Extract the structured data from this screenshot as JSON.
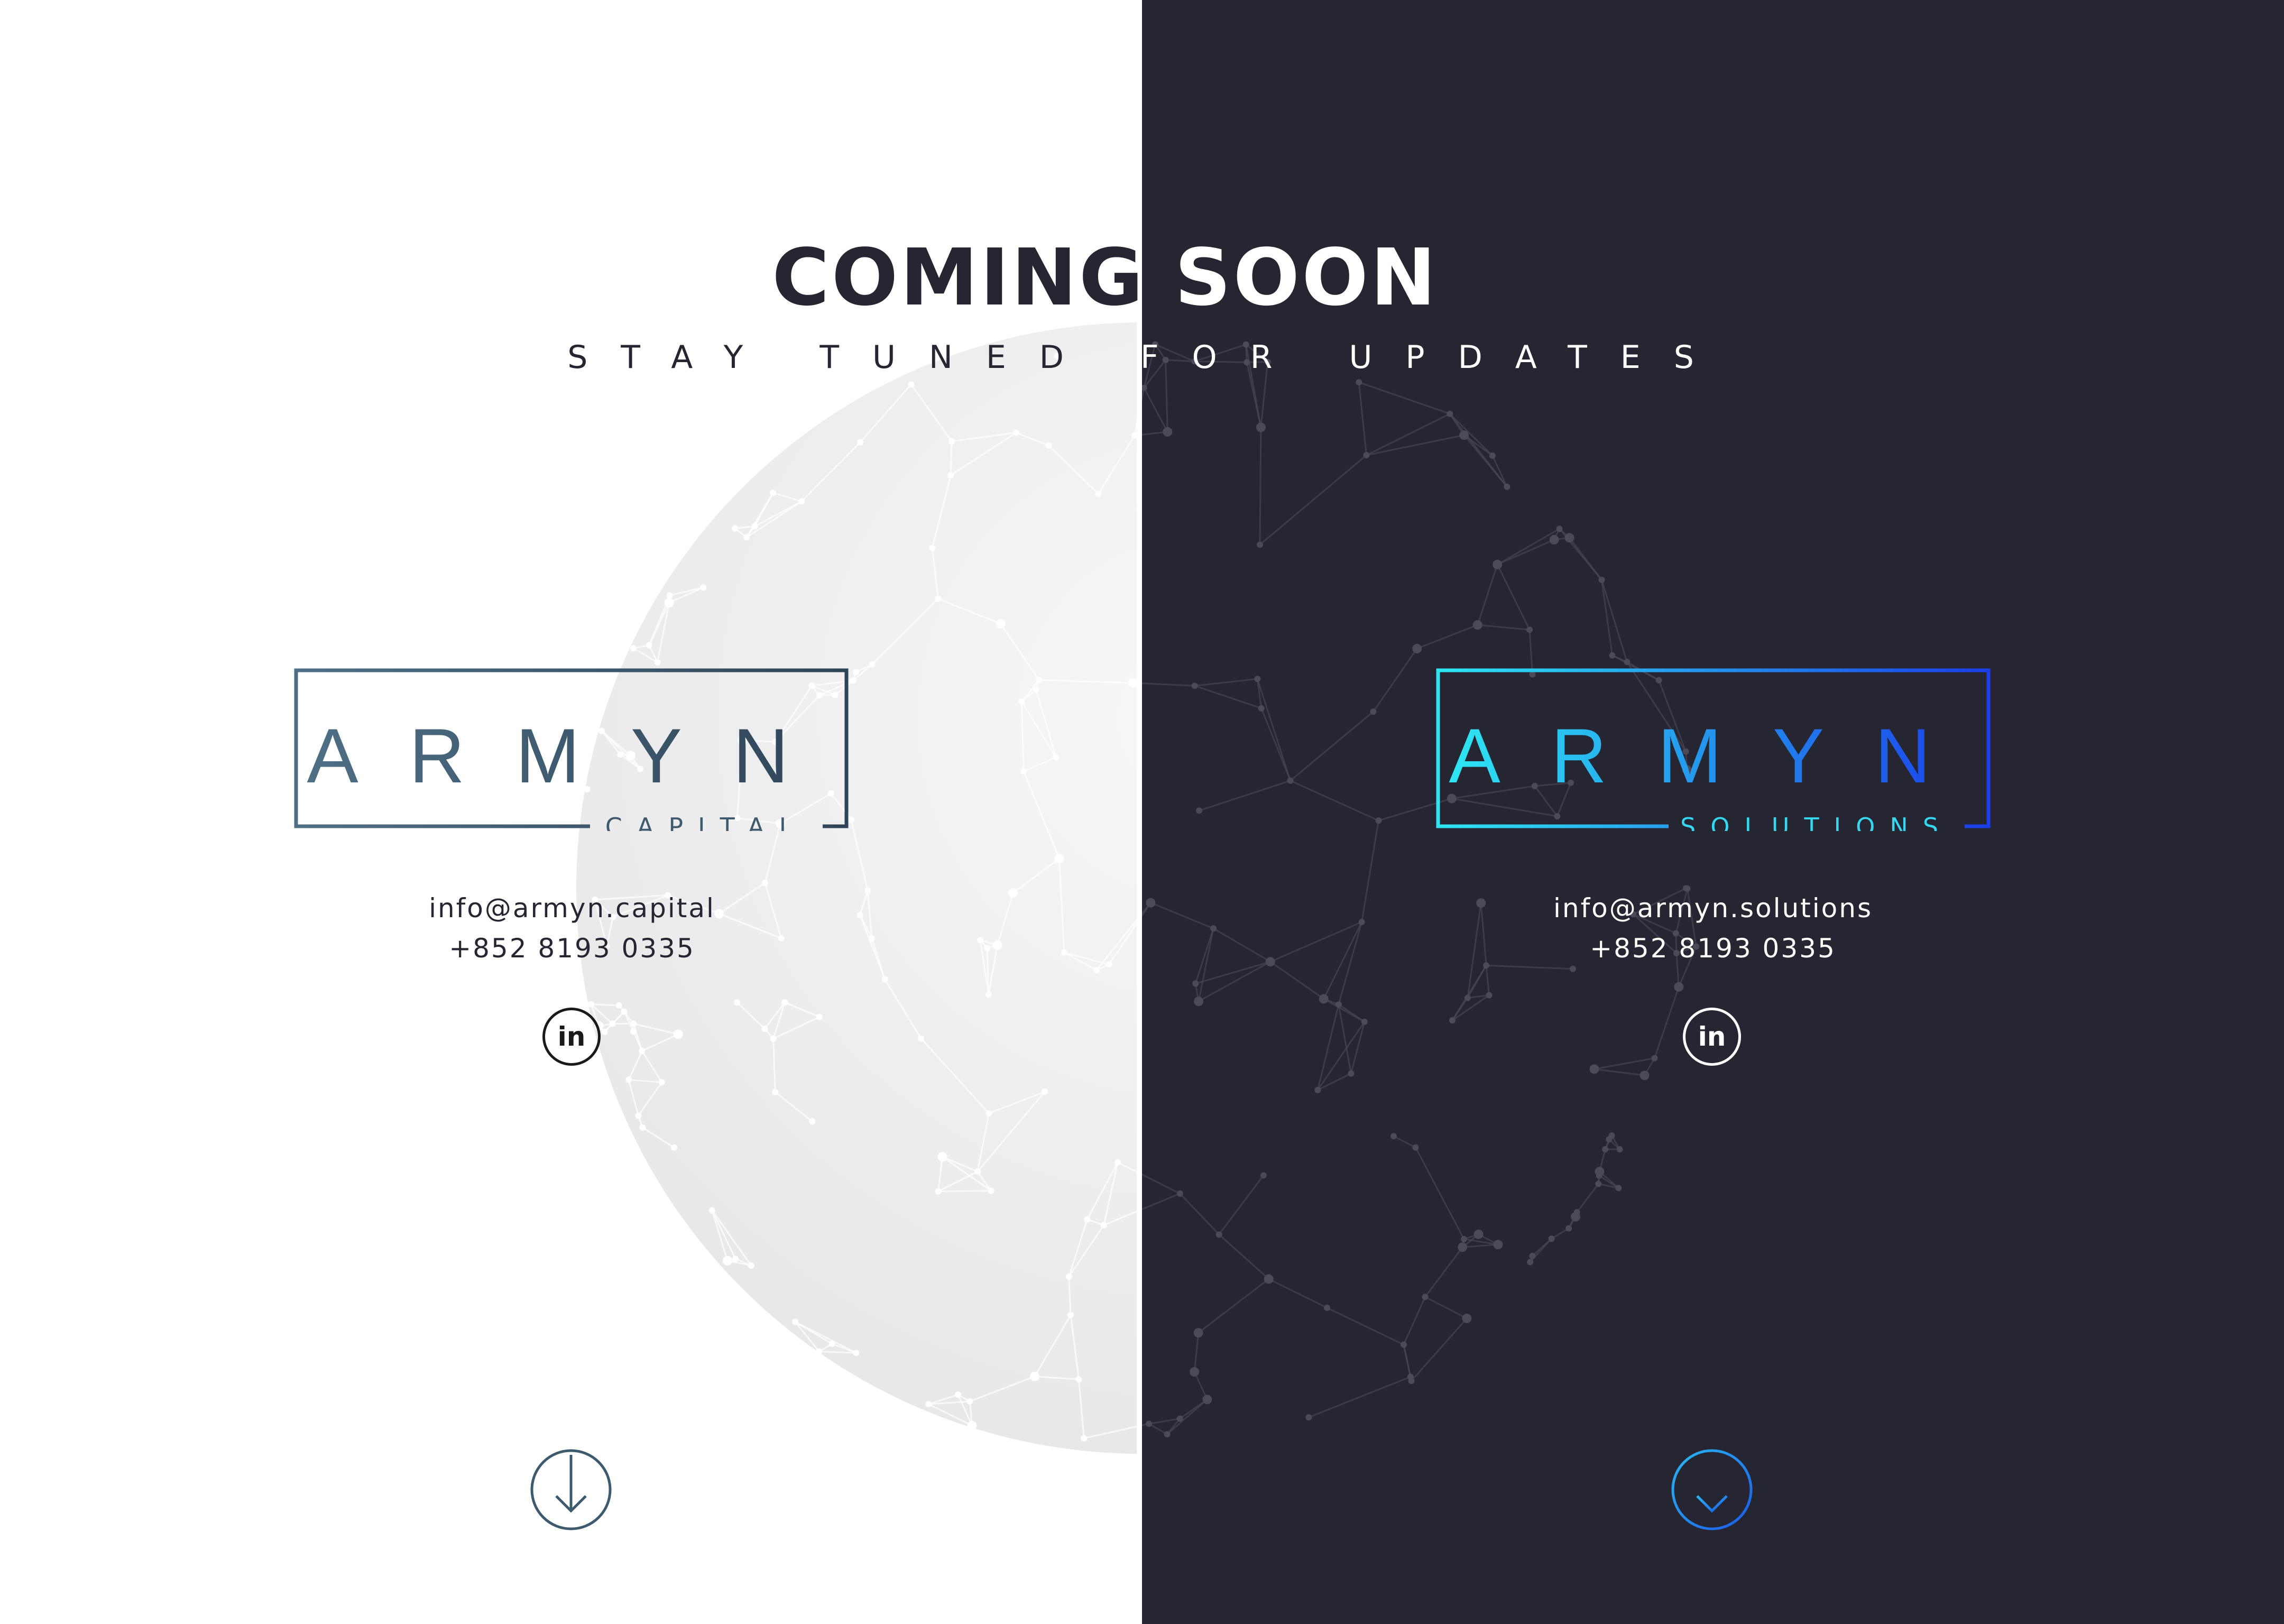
{
  "header": {
    "title": "COMING SOON",
    "subtitle": "STAY TUNED FOR UPDATES"
  },
  "panels": {
    "capital": {
      "brand": "ARMYN",
      "division": "CAPITAL",
      "email": "info@armyn.capital",
      "phone": "+852 8193 0335",
      "social_icon": "linkedin-icon",
      "social_text": "in",
      "scroll_icon": "arrow-down-circle-icon"
    },
    "solutions": {
      "brand": "ARMYN",
      "division": "SOLUTIONS",
      "email": "info@armyn.solutions",
      "phone": "+852 8193 0335",
      "social_icon": "linkedin-icon",
      "social_text": "in",
      "scroll_icon": "arrow-down-circle-icon"
    }
  },
  "colors": {
    "left_background": "#ffffff",
    "right_background": "#262632",
    "capital_logo": "#3d5a6e",
    "solutions_logo_start": "#2ee6f2",
    "solutions_logo_end": "#1a3ee8",
    "dark_text": "#262632",
    "light_text": "#ffffff"
  }
}
